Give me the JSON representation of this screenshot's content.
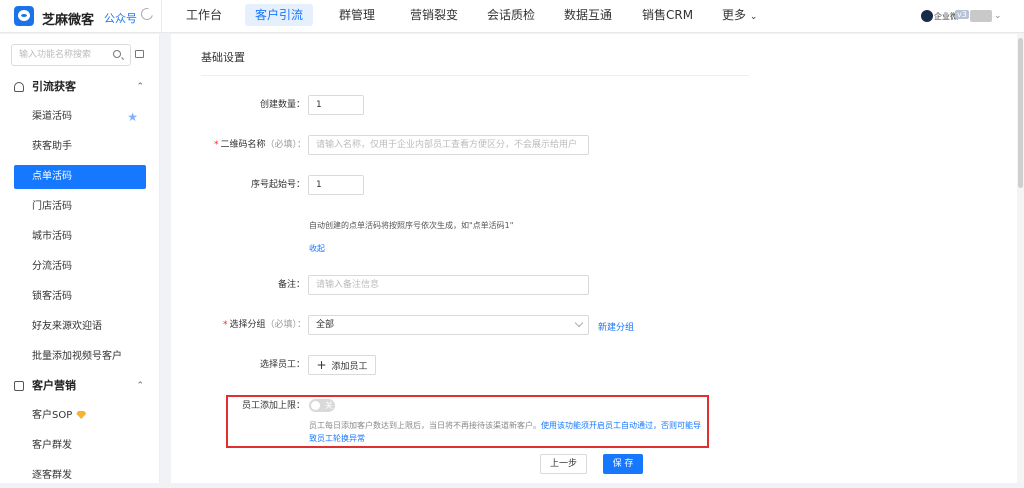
{
  "header": {
    "brand": "芝麻微客",
    "account_type": "公众号",
    "nav": [
      "工作台",
      "客户引流",
      "群管理",
      "营销裂变",
      "会话质检",
      "数据互通",
      "销售CRM",
      "更多"
    ],
    "active_nav": "客户引流",
    "user": {
      "org_label": "企业微",
      "version_badge": "v3"
    },
    "colors": {
      "accent": "#1677ff"
    }
  },
  "sidebar": {
    "search_placeholder": "输入功能名称搜索",
    "sections": [
      {
        "title": "引流获客",
        "items": [
          "渠道活码",
          "获客助手",
          "点单活码",
          "门店活码",
          "城市活码",
          "分流活码",
          "锁客活码",
          "好友来源欢迎语",
          "批量添加视频号客户"
        ],
        "active": "点单活码"
      },
      {
        "title": "客户营销",
        "items": [
          "客户SOP",
          "客户群发",
          "逐客群发"
        ]
      }
    ]
  },
  "form": {
    "page_title": "基础设置",
    "create_count": {
      "label": "创建数量：",
      "value": "1"
    },
    "qr_name": {
      "label": "二维码名称",
      "hint": "（必填）：",
      "placeholder": "请输入名称，仅用于企业内部员工查看方便区分，不会展示给用户"
    },
    "start_no": {
      "label": "序号起始号：",
      "value": "1"
    },
    "auto_note": "自动创建的点单活码将按照序号依次生成，如\"点单活码1\"",
    "collapse_link": "收起",
    "remark": {
      "label": "备注：",
      "placeholder": "请输入备注信息"
    },
    "group": {
      "label": "选择分组",
      "hint": "（必填）：",
      "value": "全部",
      "new_group": "新建分组"
    },
    "staff": {
      "label": "选择员工：",
      "add_button": "添加员工"
    },
    "limit": {
      "label": "员工添加上限：",
      "toggle_on": false,
      "toggle_text": "关",
      "warn_text": "员工每日添加客户数达到上限后，当日将不再接待该渠道新客户。",
      "warn_highlight": "使用该功能须开启员工自动通过，否则可能导致员工轮换异常"
    },
    "buttons": {
      "prev": "上一步",
      "save": "保 存"
    }
  }
}
